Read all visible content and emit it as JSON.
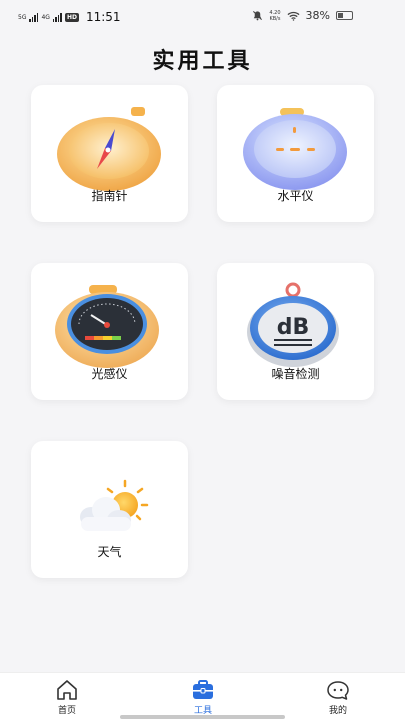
{
  "status_bar": {
    "sim1": "5G",
    "sim2": "4G",
    "hd": "HD",
    "time": "11:51",
    "net_speed_value": "4.20",
    "net_speed_unit": "KB/s",
    "battery_percent": "38%",
    "battery_level": 0.38,
    "icons": [
      "mute-icon",
      "wifi-icon",
      "battery-icon"
    ]
  },
  "page": {
    "title": "实用工具"
  },
  "tools": [
    {
      "label": "指南针",
      "icon": "compass-icon"
    },
    {
      "label": "水平仪",
      "icon": "level-icon"
    },
    {
      "label": "光感仪",
      "icon": "light-meter-icon"
    },
    {
      "label": "噪音检测",
      "icon": "noise-meter-icon"
    },
    {
      "label": "天气",
      "icon": "weather-icon"
    }
  ],
  "noise_icon_text": "dB",
  "nav": {
    "items": [
      {
        "label": "首页",
        "icon": "home-icon"
      },
      {
        "label": "工具",
        "icon": "toolbox-icon",
        "active": true
      },
      {
        "label": "我的",
        "icon": "profile-icon"
      }
    ],
    "active_color": "#2a6ede"
  }
}
